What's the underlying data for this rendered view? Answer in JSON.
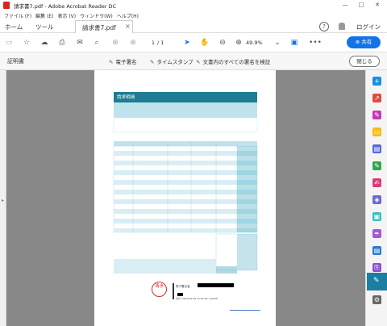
{
  "window": {
    "title": "請求書7.pdf - Adobe Acrobat Reader DC",
    "minimize": "—",
    "maximize": "□",
    "close": "✕"
  },
  "menu": [
    "ファイル (F)",
    "編集 (E)",
    "表示 (V)",
    "ウィンドウ(W)",
    "ヘルプ(H)"
  ],
  "tabs": {
    "home": "ホーム",
    "tools": "ツール",
    "document": "請求書7.pdf",
    "close_glyph": "×"
  },
  "header": {
    "help_glyph": "?",
    "login": "ログイン"
  },
  "toolbar": {
    "page_current": "1",
    "page_total": "/ 1",
    "zoom": "49.9%",
    "share": "共有"
  },
  "cert_bar": {
    "label": "証明書",
    "e_sign": "電子署名",
    "timestamp": "タイムスタンプ",
    "verify": "文書内のすべての署名を検証",
    "close": "閉じる"
  },
  "invoice": {
    "title": "請求明細",
    "seal": "清水",
    "signature_label": "電子署名者",
    "signature_date": "日付: 2020.09.28 11:02:45 +09'00'",
    "accent_color": "#3aa5bd",
    "dark_color": "#1e7d92"
  },
  "icons": {
    "sidebar": [
      "create-pdf-icon",
      "export-pdf-icon",
      "edit-pdf-icon",
      "comment-icon",
      "combine-icon",
      "sign-icon",
      "protect-icon",
      "compress-icon",
      "fill-sign-icon",
      "certificate-icon",
      "tools-icon"
    ]
  }
}
